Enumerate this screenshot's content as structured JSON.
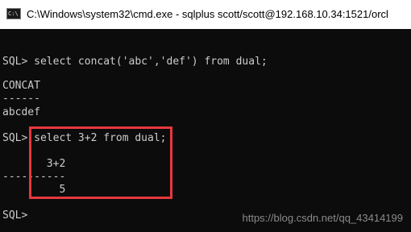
{
  "window": {
    "icon_text": "C:\\",
    "title": "C:\\Windows\\system32\\cmd.exe - sqlplus  scott/scott@192.168.10.34:1521/orcl"
  },
  "console": {
    "lines": [
      "SQL> select concat('abc','def') from dual;",
      "CONCAT",
      "------",
      "abcdef",
      "SQL> select 3+2 from dual;",
      "       3+2",
      "----------",
      "         5",
      "SQL> "
    ]
  },
  "highlight_color": "#e8383d",
  "watermark": "https://blog.csdn.net/qq_43414199"
}
